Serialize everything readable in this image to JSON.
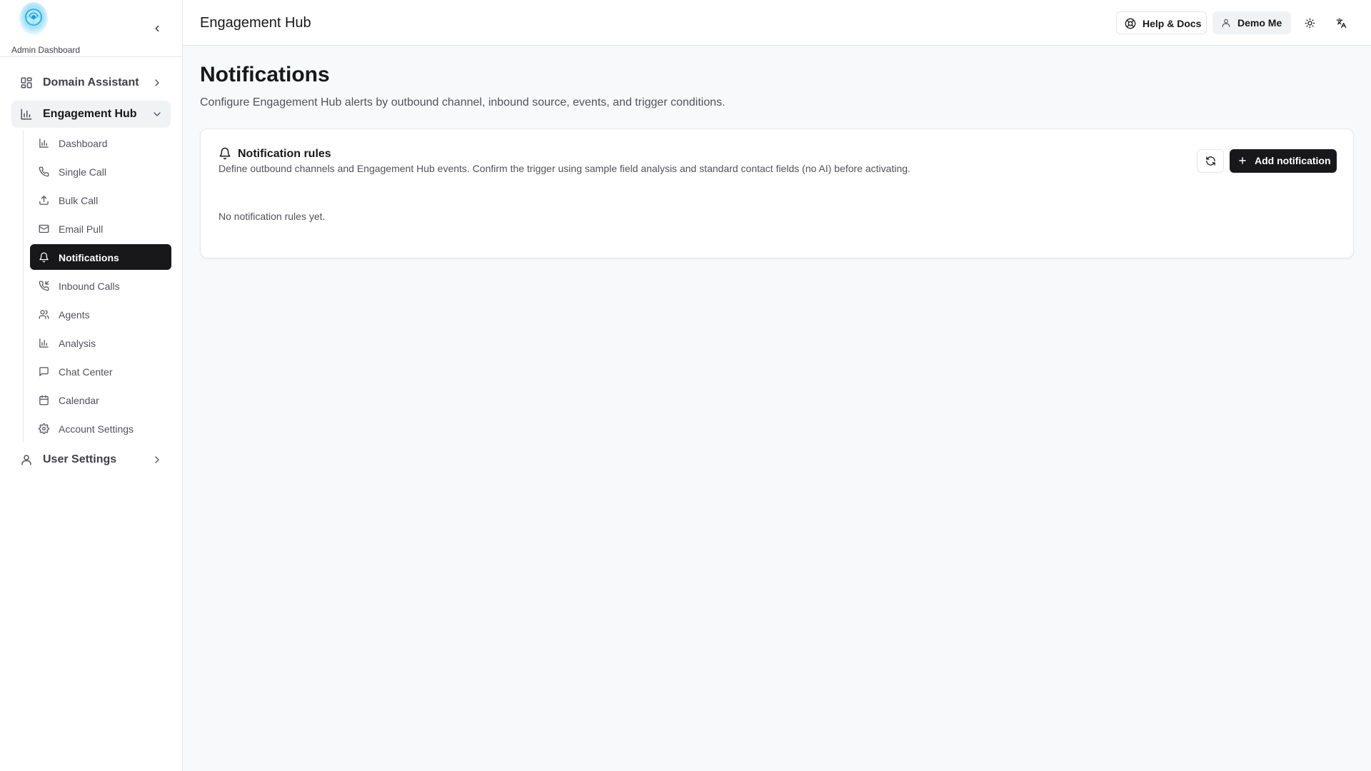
{
  "brand": {
    "label": "Admin Dashboard",
    "logo_icon": "brain-logo-icon"
  },
  "sidebar": {
    "collapse_icon": "chevron-left-icon",
    "groups": [
      {
        "label": "Domain Assistant",
        "icon": "grid-icon",
        "expanded": false
      },
      {
        "label": "Engagement Hub",
        "icon": "bar-chart-icon",
        "expanded": true
      },
      {
        "label": "User Settings",
        "icon": "user-icon",
        "expanded": false
      }
    ],
    "subitems": [
      {
        "label": "Dashboard",
        "icon": "chart-icon"
      },
      {
        "label": "Single Call",
        "icon": "phone-icon"
      },
      {
        "label": "Bulk Call",
        "icon": "upload-icon"
      },
      {
        "label": "Email Pull",
        "icon": "mail-icon"
      },
      {
        "label": "Notifications",
        "icon": "bell-icon",
        "active": true
      },
      {
        "label": "Inbound Calls",
        "icon": "phone-incoming-icon"
      },
      {
        "label": "Agents",
        "icon": "users-icon"
      },
      {
        "label": "Analysis",
        "icon": "chart-icon"
      },
      {
        "label": "Chat Center",
        "icon": "message-icon"
      },
      {
        "label": "Calendar",
        "icon": "calendar-icon"
      },
      {
        "label": "Account Settings",
        "icon": "gear-icon"
      }
    ]
  },
  "topbar": {
    "title": "Engagement Hub",
    "help_label": "Help & Docs",
    "user_label": "Demo Me",
    "theme_icon": "sun-icon",
    "language_icon": "translate-icon"
  },
  "main": {
    "title": "Notifications",
    "description": "Configure Engagement Hub alerts by outbound channel, inbound source, events, and trigger conditions.",
    "card": {
      "title": "Notification rules",
      "description": "Define outbound channels and Engagement Hub events. Confirm the trigger using sample field analysis and standard contact fields (no AI) before activating.",
      "add_label": "Add notification",
      "empty_text": "No notification rules yet."
    }
  },
  "colors": {
    "accent": "#18181b",
    "active_group_bg": "#f1f2f4",
    "page_bg": "#f8f9fb"
  }
}
